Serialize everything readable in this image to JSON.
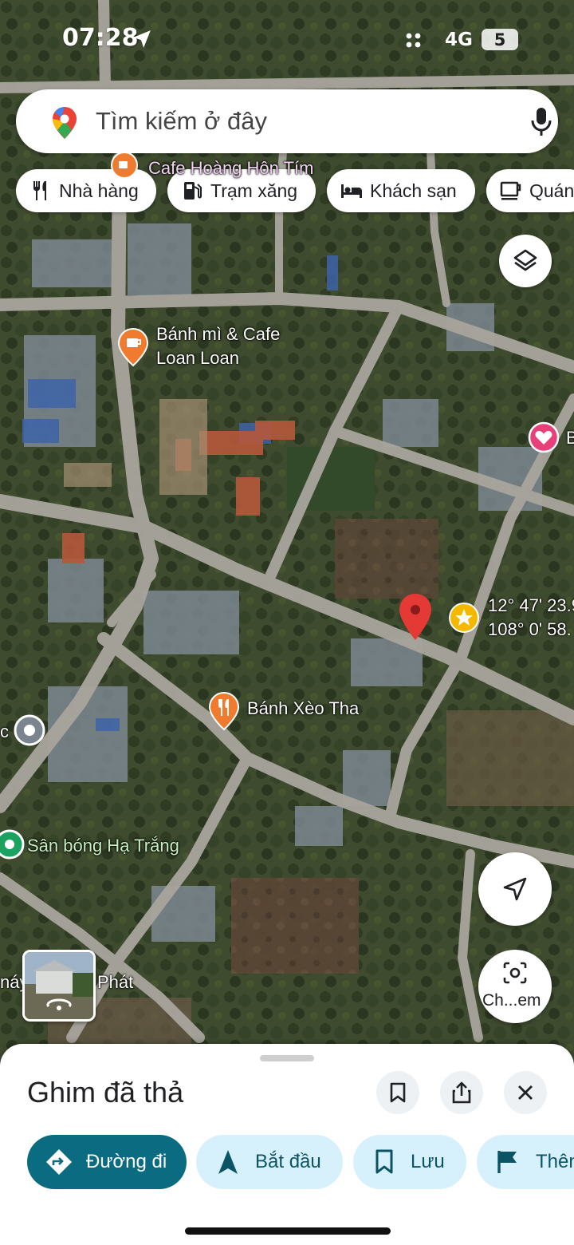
{
  "status_bar": {
    "time": "07:28",
    "network": "4G",
    "battery": "5"
  },
  "search": {
    "placeholder": "Tìm kiếm ở đây"
  },
  "categories": [
    {
      "label": "Nhà hàng",
      "icon": "restaurant-icon"
    },
    {
      "label": "Trạm xăng",
      "icon": "gas-station-icon"
    },
    {
      "label": "Khách sạn",
      "icon": "hotel-icon"
    },
    {
      "label": "Quán",
      "icon": "cafe-icon"
    }
  ],
  "map": {
    "places": [
      {
        "name": "Cafe Hoàng Hôn Tím",
        "icon": "cafe-icon",
        "color": "#f07b2e"
      },
      {
        "name_line1": "Bánh mì & Cafe",
        "name_line2": "Loan Loan",
        "icon": "cafe-icon",
        "color": "#f07b2e"
      },
      {
        "name": "Bánh Xèo Tha",
        "icon": "restaurant-icon",
        "color": "#f07b2e"
      },
      {
        "name": "Sân bóng Hạ Trắng",
        "icon": "stadium-icon",
        "color": "#1aa260"
      },
      {
        "name": "Phát"
      },
      {
        "name": "B",
        "icon": "heart-icon",
        "color": "#e8417a"
      },
      {
        "name": "c",
        "icon": "place-icon"
      },
      {
        "name": "náy"
      }
    ],
    "coordinates": {
      "lat": "12° 47' 23.9",
      "lng": "108° 0' 58."
    },
    "pin_color": "#e53935",
    "lens_label": "Ch...em"
  },
  "sheet": {
    "title": "Ghim đã thả",
    "actions": [
      {
        "label": "Đường đi",
        "icon": "directions-icon"
      },
      {
        "label": "Bắt đầu",
        "icon": "navigation-icon"
      },
      {
        "label": "Lưu",
        "icon": "bookmark-icon"
      },
      {
        "label": "Thên",
        "icon": "flag-icon"
      }
    ]
  },
  "colors": {
    "primary": "#0b6b80",
    "chip_bg": "#d6f1fb",
    "accent_orange": "#f07b2e"
  }
}
